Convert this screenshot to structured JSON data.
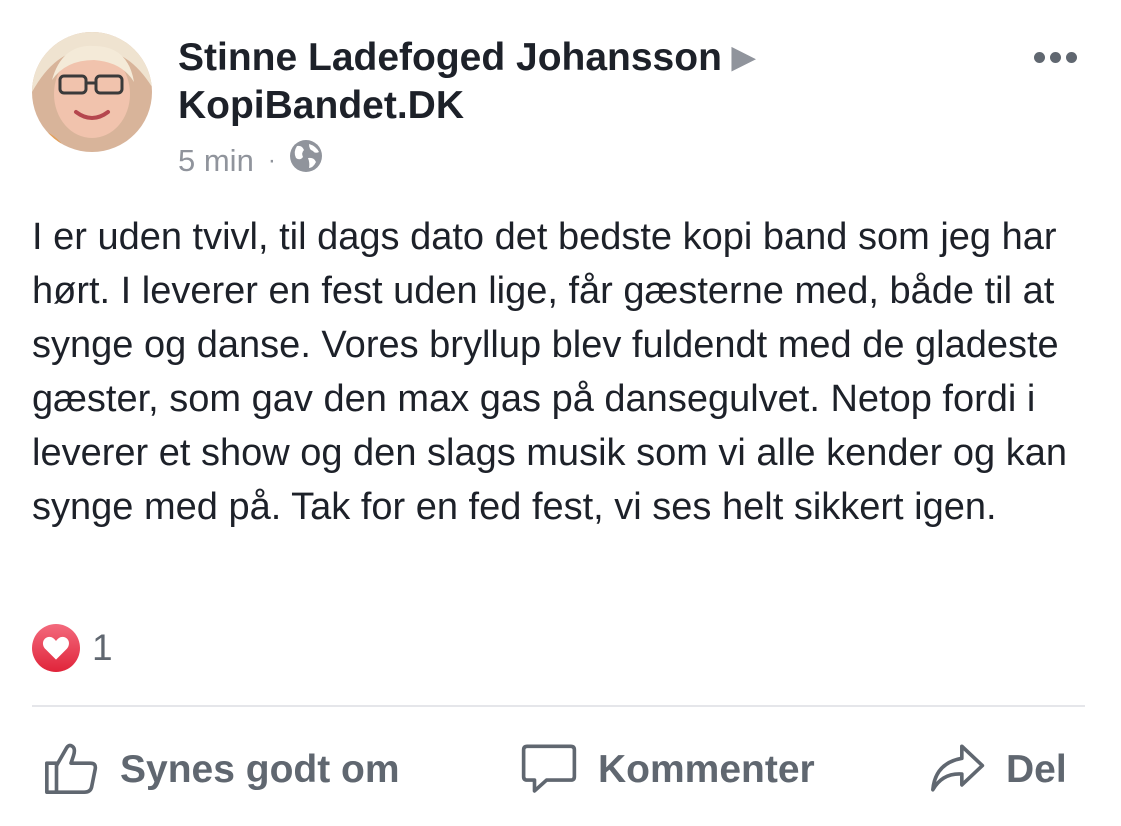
{
  "post": {
    "author": "Stinne Ladefoged Johansson",
    "target_page": "KopiBandet.DK",
    "timestamp": "5 min",
    "separator": "·",
    "audience_icon": "globe-icon",
    "text": "I er uden tvivl, til dags dato det bedste kopi band som jeg har hørt. I leverer en fest uden lige, får gæsterne med, både til at synge og danse. Vores bryllup blev fuldendt med de gladeste gæster, som gav den max gas på dansegulvet. Netop fordi i leverer et show og den slags musik som vi alle kender og kan synge med på. Tak for en fed fest, vi ses helt sikkert igen."
  },
  "reactions": {
    "icon": "heart-icon",
    "count": "1"
  },
  "actions": {
    "like": {
      "icon": "thumbs-up-icon",
      "label": "Synes godt om"
    },
    "comment": {
      "icon": "comment-bubble-icon",
      "label": "Kommenter"
    },
    "share": {
      "icon": "share-arrow-icon",
      "label": "Del"
    }
  },
  "colors": {
    "text": "#1d2129",
    "secondary": "#90949c",
    "action": "#606770",
    "love": "#e0243a"
  }
}
